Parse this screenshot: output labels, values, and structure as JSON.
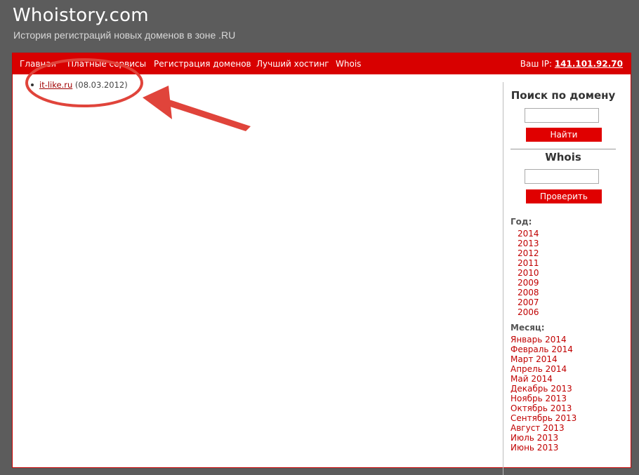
{
  "site": {
    "title": "Whoistory.com",
    "subtitle": "История регистраций новых доменов в зоне .RU"
  },
  "nav": {
    "items": [
      "Главная",
      "Платные сервисы",
      "Регистрация доменов",
      "Лучший хостинг",
      "Whois"
    ],
    "ip_label": "Ваш IP:",
    "ip_value": "141.101.92.70"
  },
  "content": {
    "domains": [
      {
        "name": "it-like.ru",
        "date": "(08.03.2012)"
      }
    ]
  },
  "sidebar": {
    "search_title": "Поиск по домену",
    "search_button": "Найти",
    "whois_title": "Whois",
    "whois_button": "Проверить",
    "year_label": "Год:",
    "years": [
      "2014",
      "2013",
      "2012",
      "2011",
      "2010",
      "2009",
      "2008",
      "2007",
      "2006"
    ],
    "month_label": "Месяц:",
    "months": [
      "Январь 2014",
      "Февраль 2014",
      "Март 2014",
      "Апрель 2014",
      "Май 2014",
      "Декабрь 2013",
      "Ноябрь 2013",
      "Октябрь 2013",
      "Сентябрь 2013",
      "Август 2013",
      "Июль 2013",
      "Июнь 2013"
    ]
  },
  "colors": {
    "page_bg": "#5c5c5c",
    "accent": "#d80000",
    "link": "#c00000",
    "annotation": "#e0443b"
  }
}
